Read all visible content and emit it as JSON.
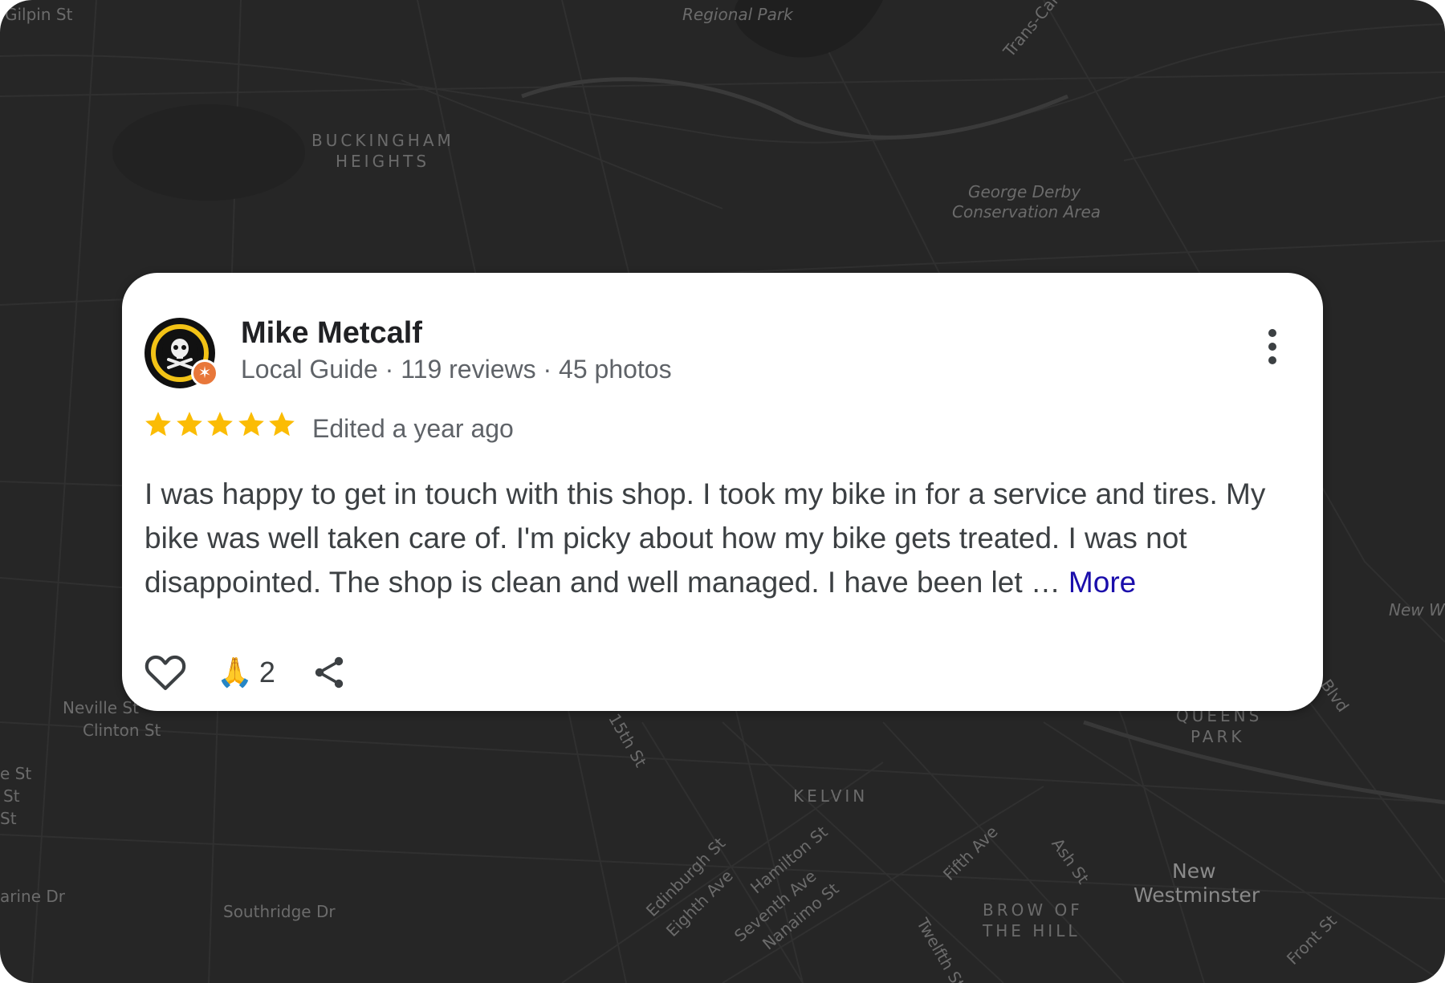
{
  "map": {
    "labels": {
      "gilpin": "Gilpin St",
      "regional_park": "Regional Park",
      "trans_canada": "Trans-Canada Hwy",
      "buckingham_1": "BUCKINGHAM",
      "buckingham_2": "HEIGHTS",
      "george_derby_1": "George Derby",
      "george_derby_2": "Conservation Area",
      "new_w": "New W",
      "neville": "Neville St",
      "clinton": "Clinton St",
      "e_st_1": "e St",
      "e_st_2": "St",
      "e_st_3": "St",
      "marine": "arine Dr",
      "southridge": "Southridge Dr",
      "fifteenth": "15th St",
      "kelvin": "KELVIN",
      "queens_park_1": "QUEENS",
      "queens_park_2": "PARK",
      "blvd": "Blvd",
      "edinburgh": "Edinburgh St",
      "eighth": "Eighth Ave",
      "hamilton": "Hamilton St",
      "seventh": "Seventh Ave",
      "nanaimo": "Nanaimo St",
      "fifth": "Fifth Ave",
      "ash": "Ash St",
      "twelfth": "Twelfth St",
      "brow_1": "BROW OF",
      "brow_2": "THE HILL",
      "new_westminster_1": "New",
      "new_westminster_2": "Westminster",
      "front": "Front St"
    }
  },
  "review": {
    "reviewer_name": "Mike Metcalf",
    "reviewer_meta": "Local Guide · 119 reviews · 45 photos",
    "avatar_icon": "pirate-skull-avatar",
    "badge_icon": "local-guide-star-badge",
    "badge_color": "#e8773a",
    "rating": 5,
    "rating_max": 5,
    "star_color": "#fbbc04",
    "edited": "Edited a year ago",
    "text": "I was happy to get in touch with this shop. I took my bike in for a service and tires. My bike was well taken care of. I'm picky about how my bike gets treated. I was not disappointed. The shop is clean and well managed. I have been let …",
    "more_label": "More",
    "more_color": "#1a0dab",
    "reaction_emoji": "🙏",
    "reaction_count": "2",
    "icons": {
      "like": "heart-icon",
      "share": "share-icon",
      "menu": "more-vert-icon"
    }
  }
}
